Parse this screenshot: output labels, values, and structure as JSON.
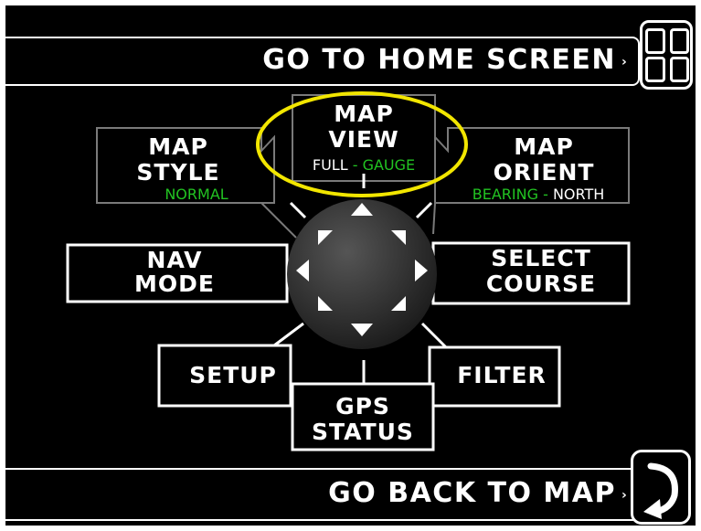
{
  "header": {
    "home_label": "GO TO HOME SCREEN",
    "home_icon": "home-grid-icon"
  },
  "footer": {
    "back_label": "GO BACK TO MAP",
    "back_icon": "return-arrow-icon"
  },
  "menu": {
    "map_view": {
      "line1": "MAP",
      "line2": "VIEW",
      "opt_a": "FULL",
      "sep": "-",
      "opt_b": "GAUGE",
      "selected": "GAUGE"
    },
    "map_style": {
      "line1": "MAP",
      "line2": "STYLE",
      "value": "NORMAL"
    },
    "map_orient": {
      "line1": "MAP",
      "line2": "ORIENT",
      "opt_a": "BEARING",
      "sep": "-",
      "opt_b": "NORTH",
      "selected": "BEARING"
    },
    "nav_mode": {
      "line1": "NAV",
      "line2": "MODE"
    },
    "select_course": {
      "line1": "SELECT",
      "line2": "COURSE"
    },
    "setup": {
      "label": "SETUP"
    },
    "gps_status": {
      "line1": "GPS",
      "line2": "STATUS"
    },
    "filter": {
      "label": "FILTER"
    }
  },
  "colors": {
    "accent_green": "#22c322",
    "highlight_yellow": "#f2e600",
    "background": "#000000",
    "foreground": "#ffffff"
  },
  "highlight": {
    "target": "map_view"
  }
}
